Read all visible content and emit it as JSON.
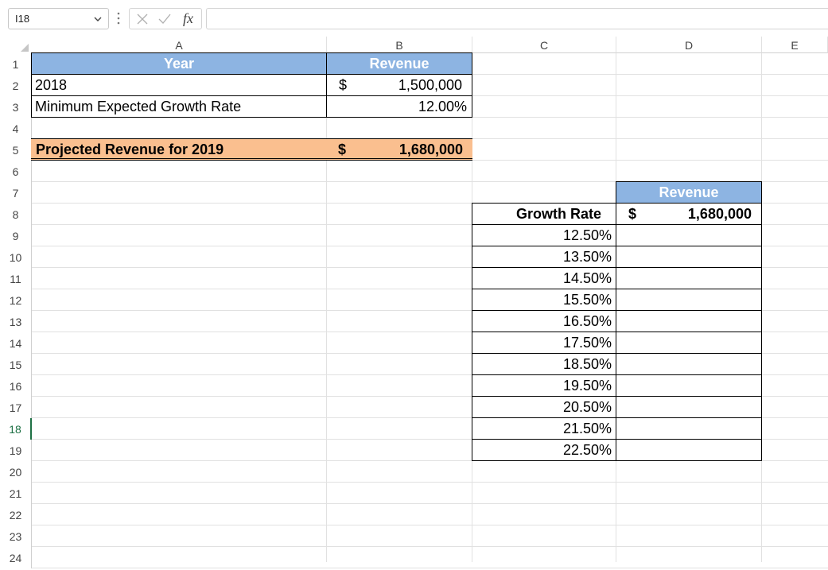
{
  "formula_bar": {
    "name_box": "I18",
    "formula": ""
  },
  "columns": [
    "A",
    "B",
    "C",
    "D",
    "E"
  ],
  "rows": [
    "1",
    "2",
    "3",
    "4",
    "5",
    "6",
    "7",
    "8",
    "9",
    "10",
    "11",
    "12",
    "13",
    "14",
    "15",
    "16",
    "17",
    "18",
    "19",
    "20",
    "21",
    "22",
    "23",
    "24"
  ],
  "selected_row": "18",
  "table1": {
    "header_year": "Year",
    "header_revenue": "Revenue",
    "r2_label": "2018",
    "r2_currency": "$",
    "r2_value": "1,500,000",
    "r3_label": "Minimum Expected Growth Rate",
    "r3_value": "12.00%",
    "r5_label": "Projected Revenue for 2019",
    "r5_currency": "$",
    "r5_value": "1,680,000"
  },
  "table2": {
    "header_revenue": "Revenue",
    "growth_rate_label": "Growth Rate",
    "currency": "$",
    "revenue_value": "1,680,000",
    "rates": [
      "12.50%",
      "13.50%",
      "14.50%",
      "15.50%",
      "16.50%",
      "17.50%",
      "18.50%",
      "19.50%",
      "20.50%",
      "21.50%",
      "22.50%"
    ]
  },
  "colors": {
    "header_blue": "#8db4e2",
    "highlight_orange": "#fabf8f",
    "selected_green": "#1e7145"
  },
  "icons": {
    "name_box_dropdown": "chevron-down-icon",
    "more": "vertical-dots-icon",
    "cancel": "x-icon",
    "enter": "check-icon",
    "insert_function": "fx-icon"
  }
}
